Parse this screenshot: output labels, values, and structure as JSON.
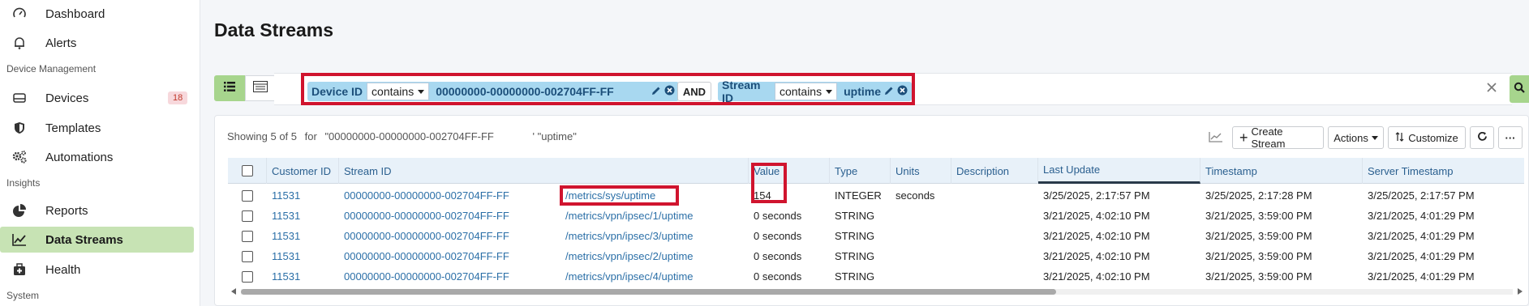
{
  "sidebar": {
    "items": [
      {
        "label": "Dashboard",
        "icon": "gauge-icon"
      },
      {
        "label": "Alerts",
        "icon": "bell-icon"
      },
      {
        "label": "Devices",
        "icon": "device-icon",
        "badge": "18"
      },
      {
        "label": "Templates",
        "icon": "shield-icon"
      },
      {
        "label": "Automations",
        "icon": "gears-icon"
      },
      {
        "label": "Reports",
        "icon": "pie-chart-icon"
      },
      {
        "label": "Data Streams",
        "icon": "line-chart-icon",
        "active": true
      },
      {
        "label": "Health",
        "icon": "medkit-icon"
      }
    ],
    "sections": {
      "device_management": "Device Management",
      "insights": "Insights",
      "system": "System"
    }
  },
  "page": {
    "title": "Data Streams"
  },
  "filter": {
    "chip1": {
      "key": "Device ID",
      "op": "contains",
      "value": "00000000-00000000-002704FF-FF"
    },
    "joiner": "AND",
    "chip2": {
      "key": "Stream ID",
      "op": "contains",
      "value": "uptime"
    }
  },
  "results": {
    "showing": "Showing 5 of 5",
    "for": "for",
    "query1": "\"00000000-00000000-002704FF-FF",
    "query2": "' \"uptime\""
  },
  "toolbar": {
    "create_stream": "Create Stream",
    "actions": "Actions",
    "customize": "Customize"
  },
  "table": {
    "columns": [
      "Customer ID",
      "Stream ID",
      "Value",
      "Type",
      "Units",
      "Description",
      "Last Update",
      "Timestamp",
      "Server Timestamp"
    ],
    "rows": [
      {
        "customer": "11531",
        "device": "00000000-00000000-002704FF-FF",
        "stream": "/metrics/sys/uptime",
        "value": "154",
        "type": "INTEGER",
        "units": "seconds",
        "description": "",
        "last_update": "3/25/2025, 2:17:57 PM",
        "timestamp": "3/25/2025, 2:17:28 PM",
        "server_timestamp": "3/25/2025, 2:17:57 PM"
      },
      {
        "customer": "11531",
        "device": "00000000-00000000-002704FF-FF",
        "stream": "/metrics/vpn/ipsec/1/uptime",
        "value": "0 seconds",
        "type": "STRING",
        "units": "",
        "description": "",
        "last_update": "3/21/2025, 4:02:10 PM",
        "timestamp": "3/21/2025, 3:59:00 PM",
        "server_timestamp": "3/21/2025, 4:01:29 PM"
      },
      {
        "customer": "11531",
        "device": "00000000-00000000-002704FF-FF",
        "stream": "/metrics/vpn/ipsec/3/uptime",
        "value": "0 seconds",
        "type": "STRING",
        "units": "",
        "description": "",
        "last_update": "3/21/2025, 4:02:10 PM",
        "timestamp": "3/21/2025, 3:59:00 PM",
        "server_timestamp": "3/21/2025, 4:01:29 PM"
      },
      {
        "customer": "11531",
        "device": "00000000-00000000-002704FF-FF",
        "stream": "/metrics/vpn/ipsec/2/uptime",
        "value": "0 seconds",
        "type": "STRING",
        "units": "",
        "description": "",
        "last_update": "3/21/2025, 4:02:10 PM",
        "timestamp": "3/21/2025, 3:59:00 PM",
        "server_timestamp": "3/21/2025, 4:01:29 PM"
      },
      {
        "customer": "11531",
        "device": "00000000-00000000-002704FF-FF",
        "stream": "/metrics/vpn/ipsec/4/uptime",
        "value": "0 seconds",
        "type": "STRING",
        "units": "",
        "description": "",
        "last_update": "3/21/2025, 4:02:10 PM",
        "timestamp": "3/21/2025, 3:59:00 PM",
        "server_timestamp": "3/21/2025, 4:01:29 PM"
      }
    ]
  },
  "colors": {
    "accent_green": "#a7d58d",
    "active_nav": "#c7e3b4",
    "highlight_red": "#d0142e",
    "chip_blue": "#a8d8f0",
    "link_blue": "#2b6fa7"
  }
}
